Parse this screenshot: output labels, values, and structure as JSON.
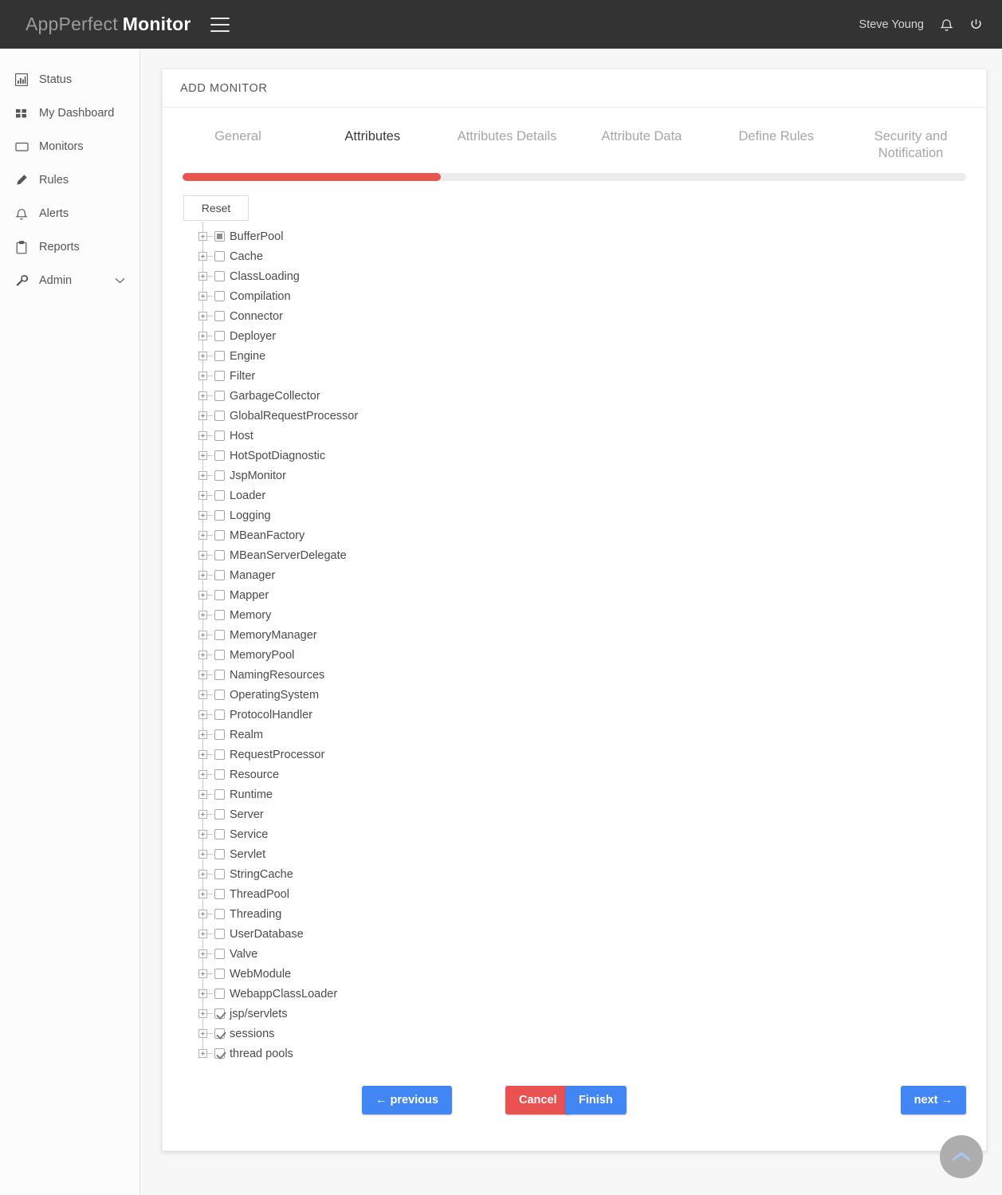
{
  "header": {
    "brand_primary": "AppPerfect",
    "brand_secondary": "Monitor",
    "user_name": "Steve Young",
    "menu_icon": "hamburger-icon",
    "bell_icon": "bell-icon",
    "power_icon": "power-icon",
    "background_color": "#333333"
  },
  "sidebar": {
    "items": [
      {
        "label": "Status",
        "icon": "bar-chart-icon"
      },
      {
        "label": "My Dashboard",
        "icon": "grid-icon"
      },
      {
        "label": "Monitors",
        "icon": "monitor-icon"
      },
      {
        "label": "Rules",
        "icon": "pencil-icon"
      },
      {
        "label": "Alerts",
        "icon": "bell-icon"
      },
      {
        "label": "Reports",
        "icon": "clipboard-icon"
      },
      {
        "label": "Admin",
        "icon": "wrench-icon",
        "chevron": "chevron-down-icon"
      }
    ]
  },
  "card": {
    "title": "ADD MONITOR",
    "tabs": [
      {
        "label": "General",
        "active": false
      },
      {
        "label": "Attributes",
        "active": true
      },
      {
        "label": "Attributes Details",
        "active": false
      },
      {
        "label": "Attribute Data",
        "active": false
      },
      {
        "label": "Define Rules",
        "active": false
      },
      {
        "label": "Security and Notification",
        "active": false
      }
    ],
    "progress": {
      "percent": 33,
      "fill_color": "#e9554e",
      "track_color": "#ececec"
    },
    "reset_label": "Reset",
    "tree": [
      {
        "label": "BufferPool",
        "state": "indeterminate"
      },
      {
        "label": "Cache",
        "state": "unchecked"
      },
      {
        "label": "ClassLoading",
        "state": "unchecked"
      },
      {
        "label": "Compilation",
        "state": "unchecked"
      },
      {
        "label": "Connector",
        "state": "unchecked"
      },
      {
        "label": "Deployer",
        "state": "unchecked"
      },
      {
        "label": "Engine",
        "state": "unchecked"
      },
      {
        "label": "Filter",
        "state": "unchecked"
      },
      {
        "label": "GarbageCollector",
        "state": "unchecked"
      },
      {
        "label": "GlobalRequestProcessor",
        "state": "unchecked"
      },
      {
        "label": "Host",
        "state": "unchecked"
      },
      {
        "label": "HotSpotDiagnostic",
        "state": "unchecked"
      },
      {
        "label": "JspMonitor",
        "state": "unchecked"
      },
      {
        "label": "Loader",
        "state": "unchecked"
      },
      {
        "label": "Logging",
        "state": "unchecked"
      },
      {
        "label": "MBeanFactory",
        "state": "unchecked"
      },
      {
        "label": "MBeanServerDelegate",
        "state": "unchecked"
      },
      {
        "label": "Manager",
        "state": "unchecked"
      },
      {
        "label": "Mapper",
        "state": "unchecked"
      },
      {
        "label": "Memory",
        "state": "unchecked"
      },
      {
        "label": "MemoryManager",
        "state": "unchecked"
      },
      {
        "label": "MemoryPool",
        "state": "unchecked"
      },
      {
        "label": "NamingResources",
        "state": "unchecked"
      },
      {
        "label": "OperatingSystem",
        "state": "unchecked"
      },
      {
        "label": "ProtocolHandler",
        "state": "unchecked"
      },
      {
        "label": "Realm",
        "state": "unchecked"
      },
      {
        "label": "RequestProcessor",
        "state": "unchecked"
      },
      {
        "label": "Resource",
        "state": "unchecked"
      },
      {
        "label": "Runtime",
        "state": "unchecked"
      },
      {
        "label": "Server",
        "state": "unchecked"
      },
      {
        "label": "Service",
        "state": "unchecked"
      },
      {
        "label": "Servlet",
        "state": "unchecked"
      },
      {
        "label": "StringCache",
        "state": "unchecked"
      },
      {
        "label": "ThreadPool",
        "state": "unchecked"
      },
      {
        "label": "Threading",
        "state": "unchecked"
      },
      {
        "label": "UserDatabase",
        "state": "unchecked"
      },
      {
        "label": "Valve",
        "state": "unchecked"
      },
      {
        "label": "WebModule",
        "state": "unchecked"
      },
      {
        "label": "WebappClassLoader",
        "state": "unchecked"
      },
      {
        "label": "jsp/servlets",
        "state": "checked"
      },
      {
        "label": "sessions",
        "state": "checked"
      },
      {
        "label": "thread pools",
        "state": "checked"
      }
    ],
    "buttons": {
      "previous": "← previous",
      "cancel": "Cancel",
      "finish": "Finish",
      "next": "next →"
    }
  },
  "scroll_top": {
    "icon": "chevron-up-icon"
  }
}
